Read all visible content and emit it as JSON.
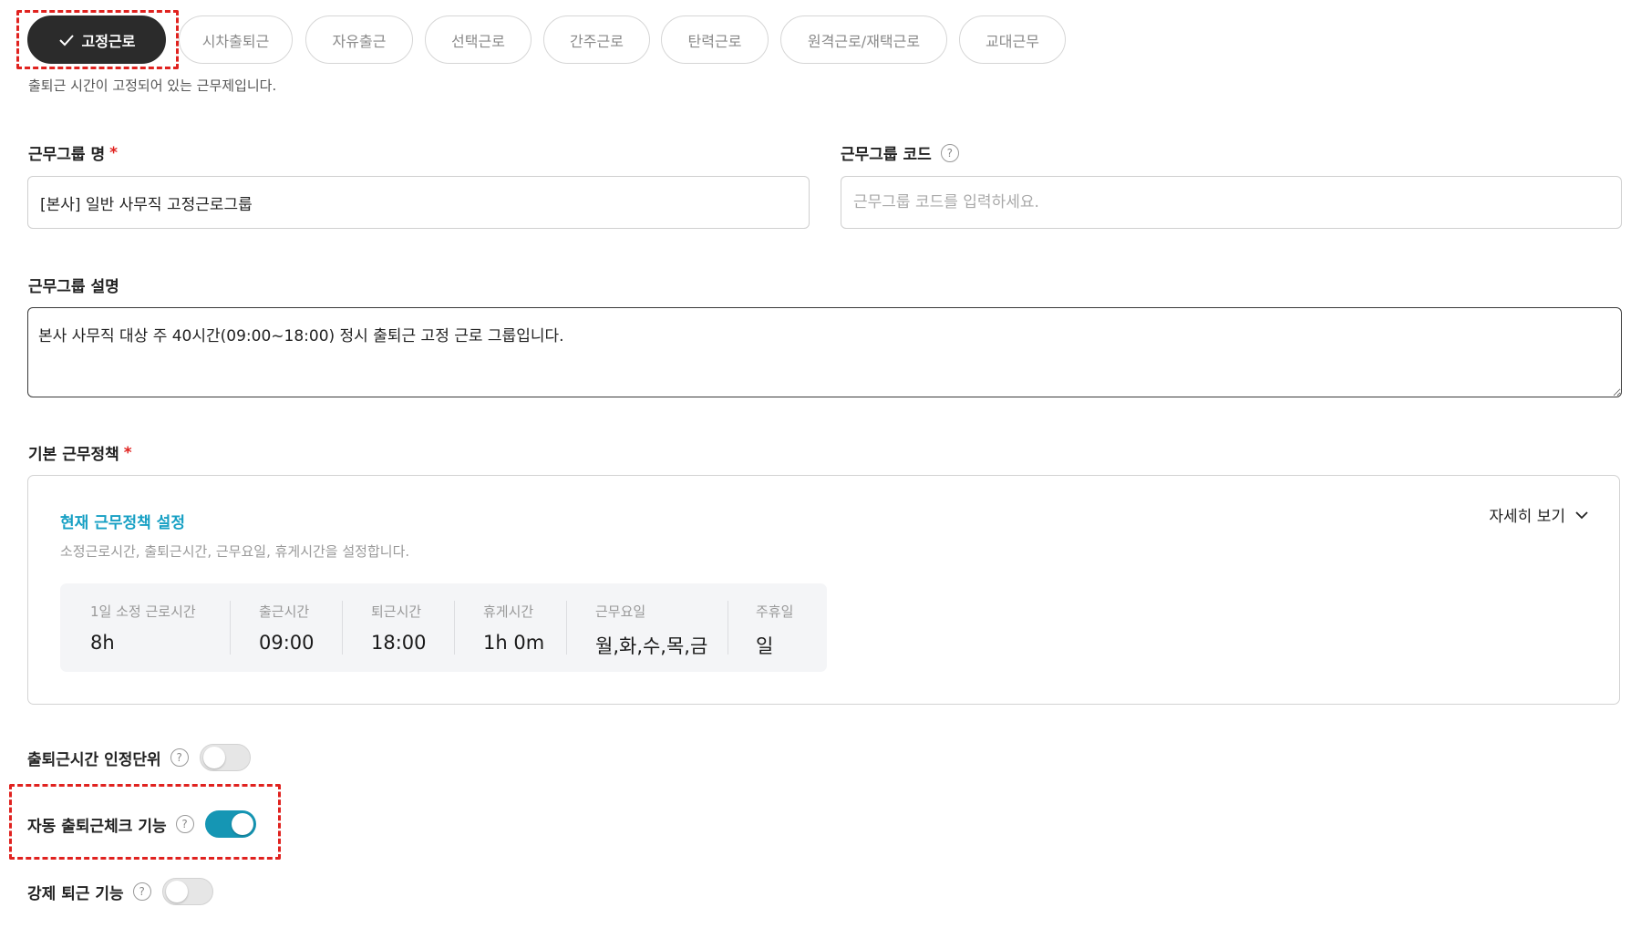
{
  "work_types": {
    "tabs": [
      {
        "label": "고정근로",
        "active": true
      },
      {
        "label": "시차출퇴근",
        "active": false
      },
      {
        "label": "자유출근",
        "active": false
      },
      {
        "label": "선택근로",
        "active": false
      },
      {
        "label": "간주근로",
        "active": false
      },
      {
        "label": "탄력근로",
        "active": false
      },
      {
        "label": "원격근로/재택근로",
        "active": false
      },
      {
        "label": "교대근무",
        "active": false
      }
    ],
    "description": "출퇴근 시간이 고정되어 있는 근무제입니다."
  },
  "form": {
    "group_name": {
      "label": "근무그룹 명",
      "required_mark": "*",
      "value": "[본사] 일반 사무직 고정근로그룹"
    },
    "group_code": {
      "label": "근무그룹 코드",
      "value": "",
      "placeholder": "근무그룹 코드를 입력하세요."
    },
    "group_desc": {
      "label": "근무그룹 설명",
      "value": "본사 사무직 대상 주 40시간(09:00~18:00) 정시 출퇴근 고정 근로 그룹입니다."
    }
  },
  "policy": {
    "label": "기본 근무정책",
    "required_mark": "*",
    "title": "현재 근무정책 설정",
    "subtitle": "소정근로시간, 출퇴근시간, 근무요일, 휴게시간을 설정합니다.",
    "detail_button": "자세히 보기",
    "summary": [
      {
        "label": "1일 소정 근로시간",
        "value": "8h"
      },
      {
        "label": "출근시간",
        "value": "09:00"
      },
      {
        "label": "퇴근시간",
        "value": "18:00"
      },
      {
        "label": "휴게시간",
        "value": "1h 0m"
      },
      {
        "label": "근무요일",
        "value": "월,화,수,목,금"
      },
      {
        "label": "주휴일",
        "value": "일"
      }
    ]
  },
  "toggles": {
    "time_unit": {
      "label": "출퇴근시간 인정단위",
      "on": false
    },
    "auto_check": {
      "label": "자동 출퇴근체크 기능",
      "on": true
    },
    "force_leave": {
      "label": "강제 퇴근 기능",
      "on": false
    }
  },
  "help_glyph": "?",
  "colors": {
    "accent": "#1596b4",
    "policy_title": "#17a0c4",
    "highlight": "#e0221f",
    "active_tab": "#2b2b2b"
  }
}
